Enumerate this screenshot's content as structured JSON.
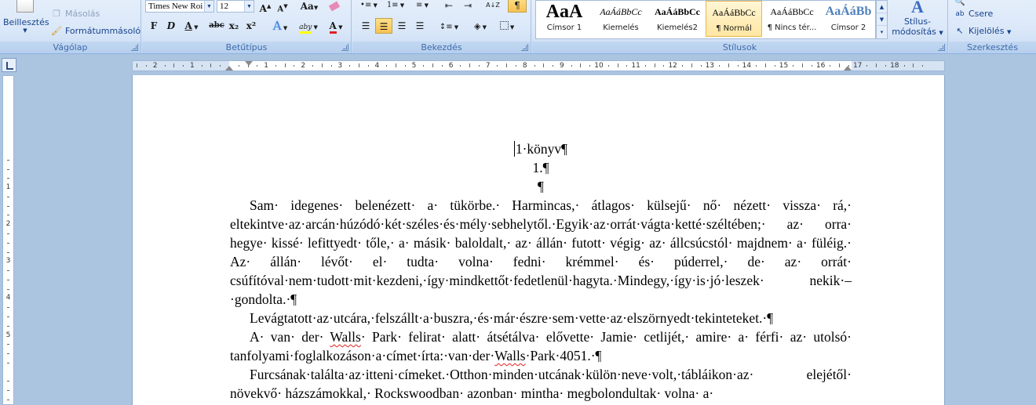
{
  "clipboard": {
    "paste_label": "Beillesztés",
    "copy_label": "Másolás",
    "format_painter_label": "Formátummásoló",
    "group_label": "Vágólap"
  },
  "font": {
    "font_name": "Times New Roi",
    "font_size": "12",
    "grow_label": "A",
    "shrink_label": "A",
    "case_label": "Aa",
    "bold_label": "F",
    "italic_label": "D",
    "underline_label": "A",
    "strike_label": "abc",
    "subscript_label": "x₂",
    "superscript_label": "x²",
    "text_effect_label": "A",
    "highlight_label": "aby",
    "font_color_label": "A",
    "group_label": "Betűtípus"
  },
  "paragraph": {
    "group_label": "Bekezdés",
    "show_marks_label": "¶",
    "sort_label": "A↓Z"
  },
  "styles": {
    "group_label": "Stílusok",
    "tiles": [
      {
        "preview": "AaA",
        "name": "Címsor 1"
      },
      {
        "preview": "AaÁáBbCc",
        "name": "Kiemelés"
      },
      {
        "preview": "AaÁáBbCc",
        "name": "Kiemelés2"
      },
      {
        "preview": "AaÁáBbCc",
        "name": "¶ Normál"
      },
      {
        "preview": "AaÁáBbCc",
        "name": "¶ Nincs tér..."
      },
      {
        "preview": "AaÁáBb",
        "name": "Címsor 2"
      }
    ],
    "change_styles_label1": "Stílus-",
    "change_styles_label2": "módosítás"
  },
  "editing": {
    "group_label": "Szerkesztés",
    "replace_label": "Csere",
    "select_label": "Kijelölés"
  },
  "ruler": {
    "numbers": [
      "2",
      "1",
      "1",
      "2",
      "3",
      "4",
      "5",
      "6",
      "7",
      "8",
      "9",
      "10",
      "11",
      "12",
      "13",
      "14",
      "15",
      "16",
      "17",
      "18"
    ],
    "vnumbers": [
      "1",
      "2",
      "3",
      "4",
      "5"
    ]
  },
  "document": {
    "line1": "1·könyv¶",
    "line2": "1.¶",
    "line3": "¶",
    "p1": "Sam· idegenes· belenézett· a· tükörbe.· Harmincas,· átlagos· külsejű· nő· nézett· vissza· rá,· eltekintve·az·arcán·húzódó·két·széles·és·mély·sebhelytől.·Egyik·az·orrát·vágta·ketté·széltében;· az· orra· hegye· kissé· lefittyedt· tőle,· a· másik· baloldalt,· az· állán· futott· végig· az· állcsúcstól· majdnem· a· füléig.· Az· állán· lévőt· el· tudta· volna· fedni· krémmel· és· púderrel,· de· az· orrát· csúfítóval·nem·tudott·mit·kezdeni,·így·mindkettőt·fedetlenül·hagyta.·Mindegy,·így·is·jó·leszek· nekik·–·gondolta.·¶",
    "p2": "Levágtatott·az·utcára,·felszállt·a·buszra,·és·már·észre·sem·vette·az·elszörnyedt·tekinteteket.·¶",
    "p3_a": "A· van· der· ",
    "p3_walls1": "Walls",
    "p3_b": "· Park· felirat· alatt· átsétálva· elővette· Jamie· cetlijét,· amire· a· férfi· az· utolsó· tanfolyami·foglalkozáson·a·címet·írta:·van·der·",
    "p3_walls2": "Walls",
    "p3_c": "·Park·4051.·¶",
    "p4": "Furcsának·találta·az·itteni·címeket.·Otthon·minden·utcának·külön·neve·volt,·tábláikon·az· elejétől· növekvő· házszámokkal,· Rockswoodban· azonban· mintha· megbolondultak· volna· a·"
  }
}
